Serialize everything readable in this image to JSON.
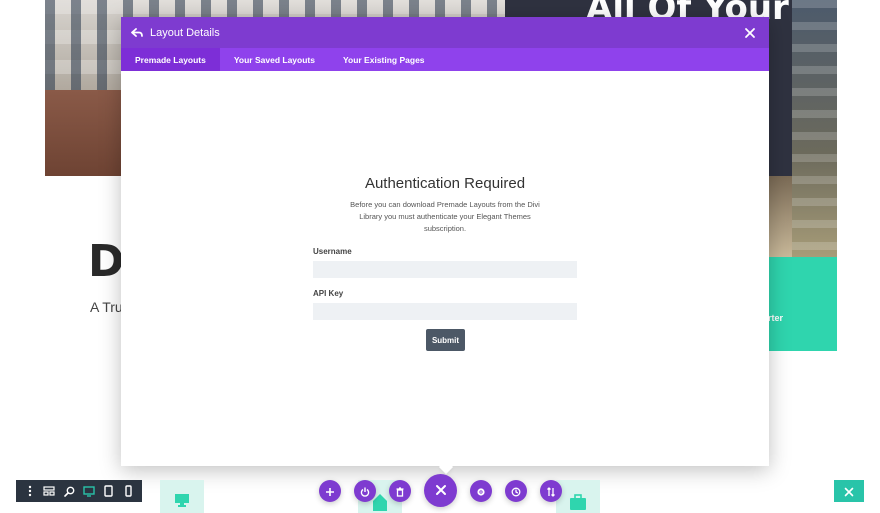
{
  "background": {
    "hero_title": "All Of Your",
    "big_letters": "Di",
    "subtitle": "A Tru",
    "green_box_text": "arter"
  },
  "modal": {
    "title": "Layout Details",
    "tabs": [
      {
        "label": "Premade Layouts",
        "active": true
      },
      {
        "label": "Your Saved Layouts",
        "active": false
      },
      {
        "label": "Your Existing Pages",
        "active": false
      }
    ],
    "auth": {
      "title": "Authentication Required",
      "description": "Before you can download Premade Layouts from the Divi Library you must authenticate your Elegant Themes subscription.",
      "username_label": "Username",
      "username_value": "",
      "api_key_label": "API Key",
      "api_key_value": "",
      "submit_label": "Submit"
    }
  },
  "bottom_bar": {
    "responsive_icons": [
      "dots-vertical-icon",
      "layers-icon",
      "zoom-icon",
      "desktop-icon",
      "tablet-icon",
      "phone-icon"
    ],
    "fab_icons": [
      "plus-icon",
      "power-icon",
      "trash-icon",
      "close-icon",
      "gear-icon",
      "history-icon",
      "sort-icon"
    ],
    "colors": {
      "purple": "#7e3bd0",
      "teal": "#29c4a9",
      "dark": "#2b3440",
      "tab_bar": "#8f42ec"
    }
  }
}
